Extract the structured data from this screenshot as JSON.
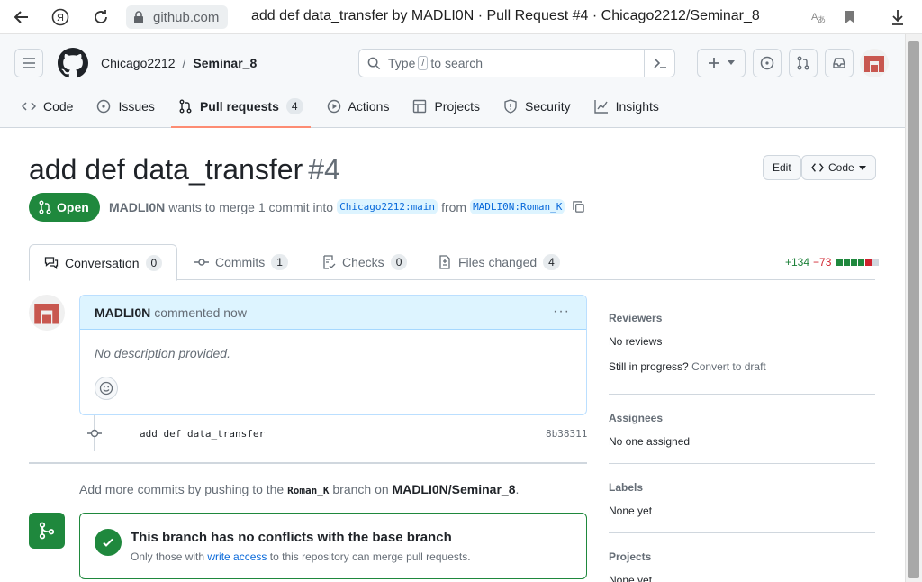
{
  "browser": {
    "domain": "github.com",
    "page_title": "add def data_transfer by MADLI0N · Pull Request #4 · Chicago2212/Seminar_8"
  },
  "header": {
    "owner": "Chicago2212",
    "separator": "/",
    "repo": "Seminar_8",
    "search_prefix": "Type",
    "search_key": "/",
    "search_suffix": "to search"
  },
  "repo_nav": [
    {
      "label": "Code",
      "icon": "code-icon"
    },
    {
      "label": "Issues",
      "icon": "issue-icon"
    },
    {
      "label": "Pull requests",
      "icon": "pull-request-icon",
      "count": "4",
      "active": true
    },
    {
      "label": "Actions",
      "icon": "play-icon"
    },
    {
      "label": "Projects",
      "icon": "table-icon"
    },
    {
      "label": "Security",
      "icon": "shield-icon"
    },
    {
      "label": "Insights",
      "icon": "graph-icon"
    }
  ],
  "pr": {
    "title": "add def data_transfer",
    "number": "#4",
    "edit_label": "Edit",
    "code_label": "Code",
    "state": "Open",
    "author": "MADLI0N",
    "merge_text": "wants to merge 1 commit into",
    "base_branch": "Chicago2212:main",
    "from_text": "from",
    "head_branch": "MADLI0N:Roman_K"
  },
  "tabs": [
    {
      "label": "Conversation",
      "count": "0"
    },
    {
      "label": "Commits",
      "count": "1"
    },
    {
      "label": "Checks",
      "count": "0"
    },
    {
      "label": "Files changed",
      "count": "4"
    }
  ],
  "diffstat": {
    "additions": "+134",
    "deletions": "−73",
    "boxes": [
      "#1f883d",
      "#1f883d",
      "#1f883d",
      "#1f883d",
      "#cf222e",
      "#d0d7de"
    ]
  },
  "comment": {
    "author": "MADLI0N",
    "time_text": "commented now",
    "body": "No description provided.",
    "menu": "···"
  },
  "commit": {
    "message": "add def data_transfer",
    "sha": "8b38311"
  },
  "push_note": {
    "prefix": "Add more commits by pushing to the",
    "branch": "Roman_K",
    "middle": "branch on",
    "repo": "MADLI0N/Seminar_8",
    "suffix": "."
  },
  "merge": {
    "title": "This branch has no conflicts with the base branch",
    "sub_prefix": "Only those with",
    "sub_link": "write access",
    "sub_suffix": "to this repository can merge pull requests."
  },
  "sidebar": {
    "reviewers": {
      "heading": "Reviewers",
      "value": "No reviews",
      "progress": "Still in progress?",
      "link": "Convert to draft"
    },
    "assignees": {
      "heading": "Assignees",
      "value": "No one assigned"
    },
    "labels": {
      "heading": "Labels",
      "value": "None yet"
    },
    "projects": {
      "heading": "Projects",
      "value": "None yet"
    }
  },
  "colors": {
    "accent_green": "#1f883d",
    "link_blue": "#0969da",
    "active_tab_underline": "#fd8c73"
  }
}
